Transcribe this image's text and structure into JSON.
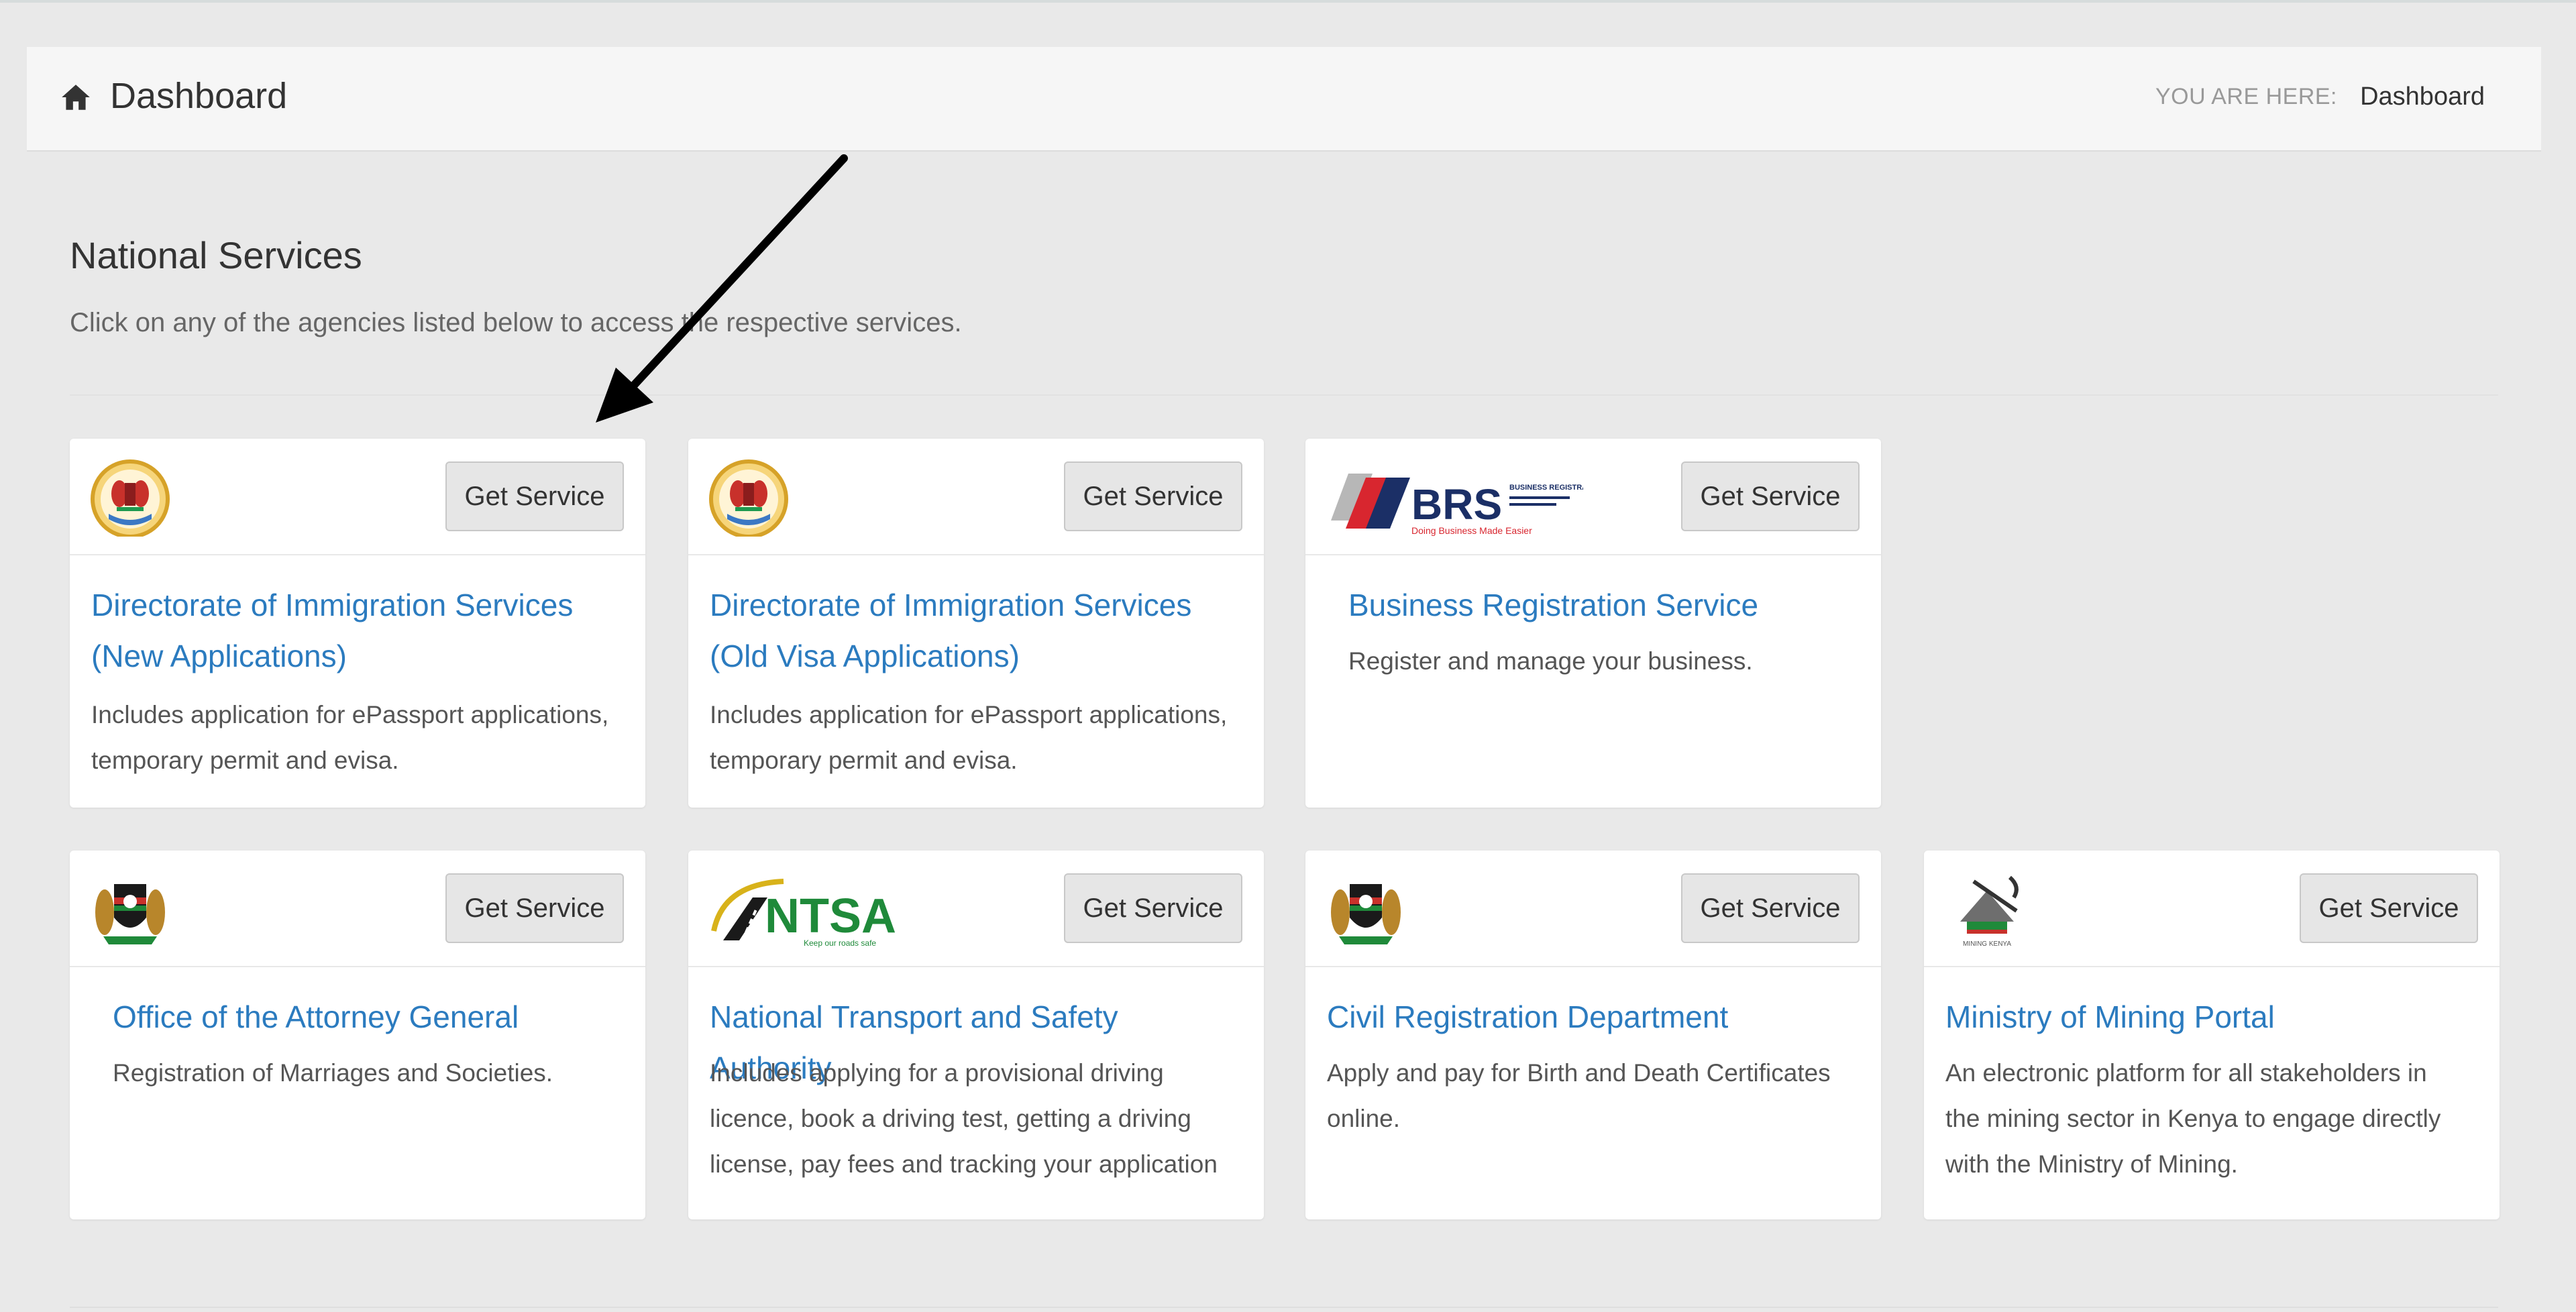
{
  "header": {
    "title": "Dashboard",
    "breadcrumb_label": "YOU ARE HERE:",
    "breadcrumb_current": "Dashboard"
  },
  "section": {
    "title": "National Services",
    "subtitle": "Click on any of the agencies listed below to access the respective services."
  },
  "button_label": "Get Service",
  "colors": {
    "link": "#2b7bbf",
    "background": "#e9e9e9"
  },
  "cards": [
    {
      "title_line1": "Directorate of Immigration Services",
      "title_line2": "(New Applications)",
      "desc_line1": "Includes application for ePassport applications,",
      "desc_line2": "temporary permit and evisa.",
      "logo": "immigration-seal-icon"
    },
    {
      "title_line1": "Directorate of Immigration Services",
      "title_line2": "(Old Visa Applications)",
      "desc_line1": "Includes application for ePassport applications,",
      "desc_line2": "temporary permit and evisa.",
      "logo": "immigration-seal-icon"
    },
    {
      "title_line1": "Business Registration Service",
      "desc_line1": "Register and manage your business.",
      "logo": "brs-logo",
      "logo_text": "BRS",
      "logo_small": "BUSINESS REGISTRATION SERVICE",
      "logo_tag": "Doing Business Made Easier"
    },
    {
      "title_line1": "Office of the Attorney General",
      "desc_line1": "Registration of Marriages and Societies.",
      "logo": "kenya-coat-of-arms-icon"
    },
    {
      "title_line1": "National Transport and Safety Authority",
      "desc_line1": "Includes applying for a provisional driving",
      "desc_line2": "licence, book a driving test, getting a driving",
      "desc_line3": "license, pay fees and tracking your application",
      "logo": "ntsa-logo",
      "logo_text": "NTSA",
      "logo_tag": "Keep our roads safe"
    },
    {
      "title_line1": "Civil Registration Department",
      "desc_line1": "Apply and pay for Birth and Death Certificates",
      "desc_line2": "online.",
      "logo": "kenya-coat-of-arms-icon"
    },
    {
      "title_line1": "Ministry of Mining Portal",
      "desc_line1": "An electronic platform for all stakeholders in",
      "desc_line2": "the mining sector in Kenya to engage directly",
      "desc_line3": "with the Ministry of Mining.",
      "logo": "mining-logo",
      "logo_tag": "MINING KENYA"
    }
  ]
}
